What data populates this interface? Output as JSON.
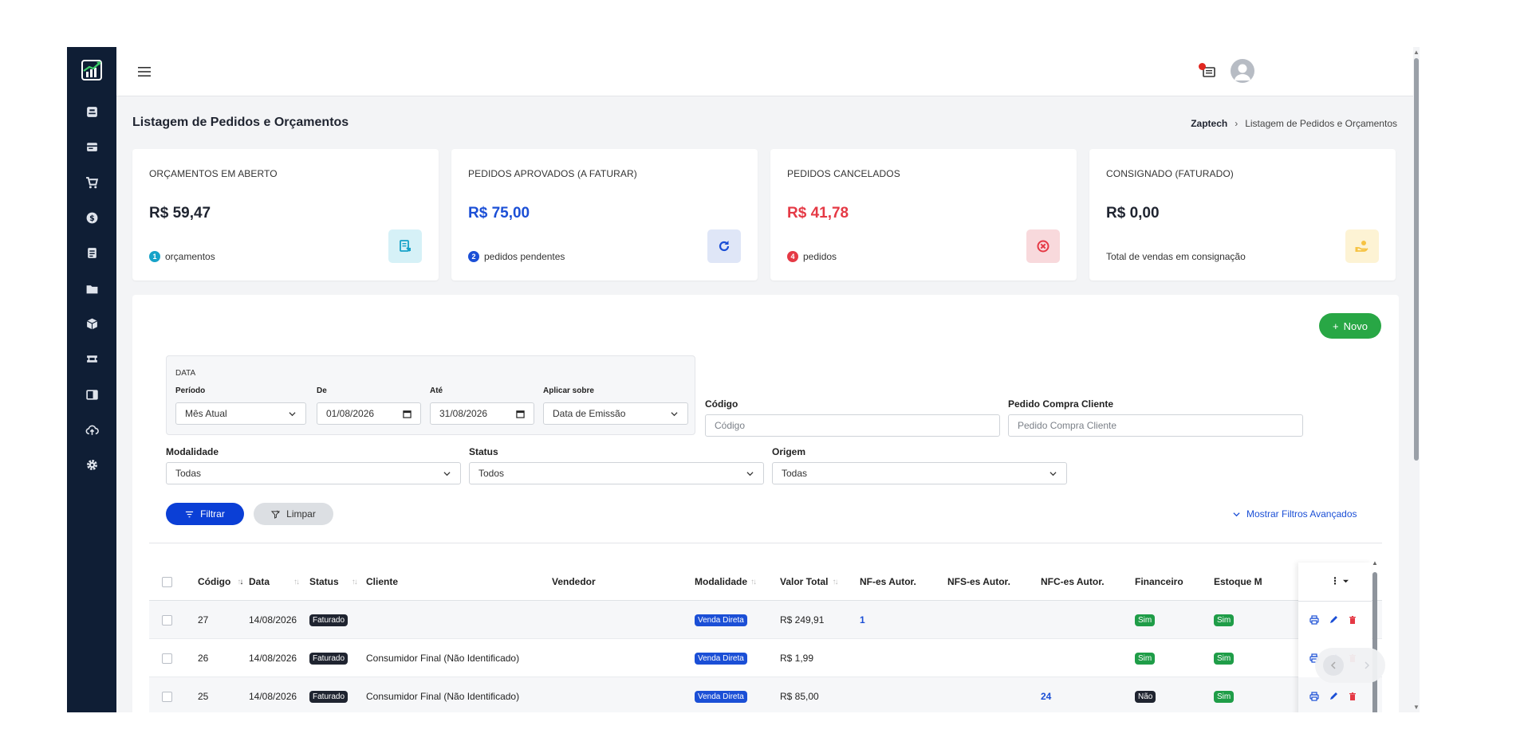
{
  "page": {
    "title": "Listagem de Pedidos e Orçamentos",
    "breadcrumb": [
      "Zaptech",
      "Listagem de Pedidos e Orçamentos"
    ]
  },
  "sidebar": {
    "icons": [
      "logo-chart-icon",
      "box-icon",
      "wallet-icon",
      "cart-icon",
      "coin-icon",
      "clipboard-icon",
      "folder-icon",
      "cube-icon",
      "ticket-icon",
      "document-icon",
      "cloud-upload-icon",
      "gear-icon"
    ]
  },
  "colors": {
    "sidebar": "#0f1e35",
    "primary": "#0b3fd6",
    "success": "#28a745",
    "danger": "#e53945",
    "warning": "#f6c343",
    "info": "#17a2c8"
  },
  "cards": [
    {
      "title": "ORÇAMENTOS EM ABERTO",
      "value": "R$ 59,47",
      "count": "1",
      "sub": "orçamentos",
      "icon": "receipt-icon"
    },
    {
      "title": "PEDIDOS APROVADOS (A FATURAR)",
      "value": "R$ 75,00",
      "count": "2",
      "sub": "pedidos pendentes",
      "icon": "refresh-icon"
    },
    {
      "title": "PEDIDOS CANCELADOS",
      "value": "R$ 41,78",
      "count": "4",
      "sub": "pedidos",
      "icon": "cancel-icon"
    },
    {
      "title": "CONSIGNADO (FATURADO)",
      "value": "R$ 0,00",
      "count": "",
      "sub": "Total de vendas em consignação",
      "icon": "hand-coins-icon"
    }
  ],
  "toolbar": {
    "new_label": "Novo"
  },
  "filters": {
    "date_legend": "DATA",
    "periodo": {
      "label": "Período",
      "value": "Mês Atual"
    },
    "de": {
      "label": "De",
      "value": "01/08/2026"
    },
    "ate": {
      "label": "Até",
      "value": "31/08/2026"
    },
    "aplicar": {
      "label": "Aplicar sobre",
      "value": "Data de Emissão"
    },
    "codigo": {
      "label": "Código",
      "placeholder": "Código"
    },
    "pedido_cliente": {
      "label": "Pedido Compra Cliente",
      "placeholder": "Pedido Compra Cliente"
    },
    "modalidade": {
      "label": "Modalidade",
      "value": "Todas"
    },
    "status": {
      "label": "Status",
      "value": "Todos"
    },
    "origem": {
      "label": "Origem",
      "value": "Todas"
    },
    "filter_label": "Filtrar",
    "clear_label": "Limpar",
    "advanced_label": "Mostrar Filtros Avançados"
  },
  "table": {
    "columns": [
      "Código",
      "Data",
      "Status",
      "Cliente",
      "Vendedor",
      "Modalidade",
      "Valor Total",
      "NF-es Autor.",
      "NFS-es Autor.",
      "NFC-es Autor.",
      "Financeiro",
      "Estoque M"
    ],
    "rows": [
      {
        "codigo": "27",
        "data": "14/08/2026",
        "status": "Faturado",
        "cliente": "",
        "vendedor": "",
        "modalidade": "Venda Direta",
        "valor": "R$ 249,91",
        "nfe": "1",
        "nfse": "",
        "nfce": "",
        "financeiro": "Sim",
        "estoque": "Sim"
      },
      {
        "codigo": "26",
        "data": "14/08/2026",
        "status": "Faturado",
        "cliente": "Consumidor Final (Não Identificado)",
        "vendedor": "",
        "modalidade": "Venda Direta",
        "valor": "R$ 1,99",
        "nfe": "",
        "nfse": "",
        "nfce": "",
        "financeiro": "Sim",
        "estoque": "Sim"
      },
      {
        "codigo": "25",
        "data": "14/08/2026",
        "status": "Faturado",
        "cliente": "Consumidor Final (Não Identificado)",
        "vendedor": "",
        "modalidade": "Venda Direta",
        "valor": "R$ 85,00",
        "nfe": "",
        "nfse": "",
        "nfce": "24",
        "financeiro": "Não",
        "estoque": "Sim"
      }
    ]
  }
}
